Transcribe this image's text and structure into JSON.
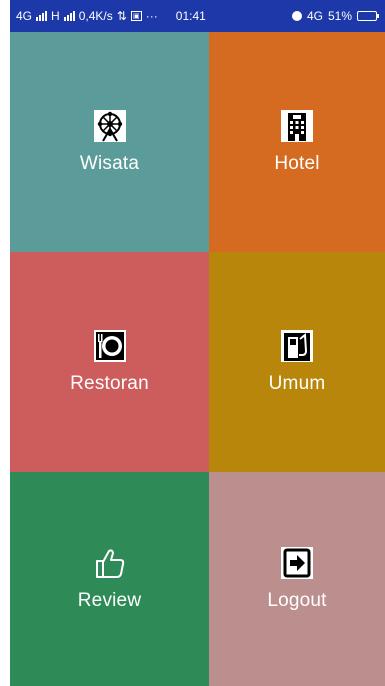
{
  "status_bar": {
    "network_1": "4G",
    "network_2": "H",
    "speed": "0,4K/s",
    "more": "···",
    "time": "01:41",
    "network_right": "4G",
    "battery_text": "51%",
    "battery_level": 0.51
  },
  "menu": {
    "tiles": [
      {
        "label": "Wisata",
        "color": "#5b9c9a",
        "icon": "attraction-icon"
      },
      {
        "label": "Hotel",
        "color": "#d56a21",
        "icon": "hotel-building-icon"
      },
      {
        "label": "Restoran",
        "color": "#cd5c5c",
        "icon": "plate-cutlery-icon"
      },
      {
        "label": "Umum",
        "color": "#b8860b",
        "icon": "fuel-pump-icon"
      },
      {
        "label": "Review",
        "color": "#2e8b57",
        "icon": "thumbs-up-icon"
      },
      {
        "label": "Logout",
        "color": "#bc8f8f",
        "icon": "logout-icon"
      }
    ]
  }
}
